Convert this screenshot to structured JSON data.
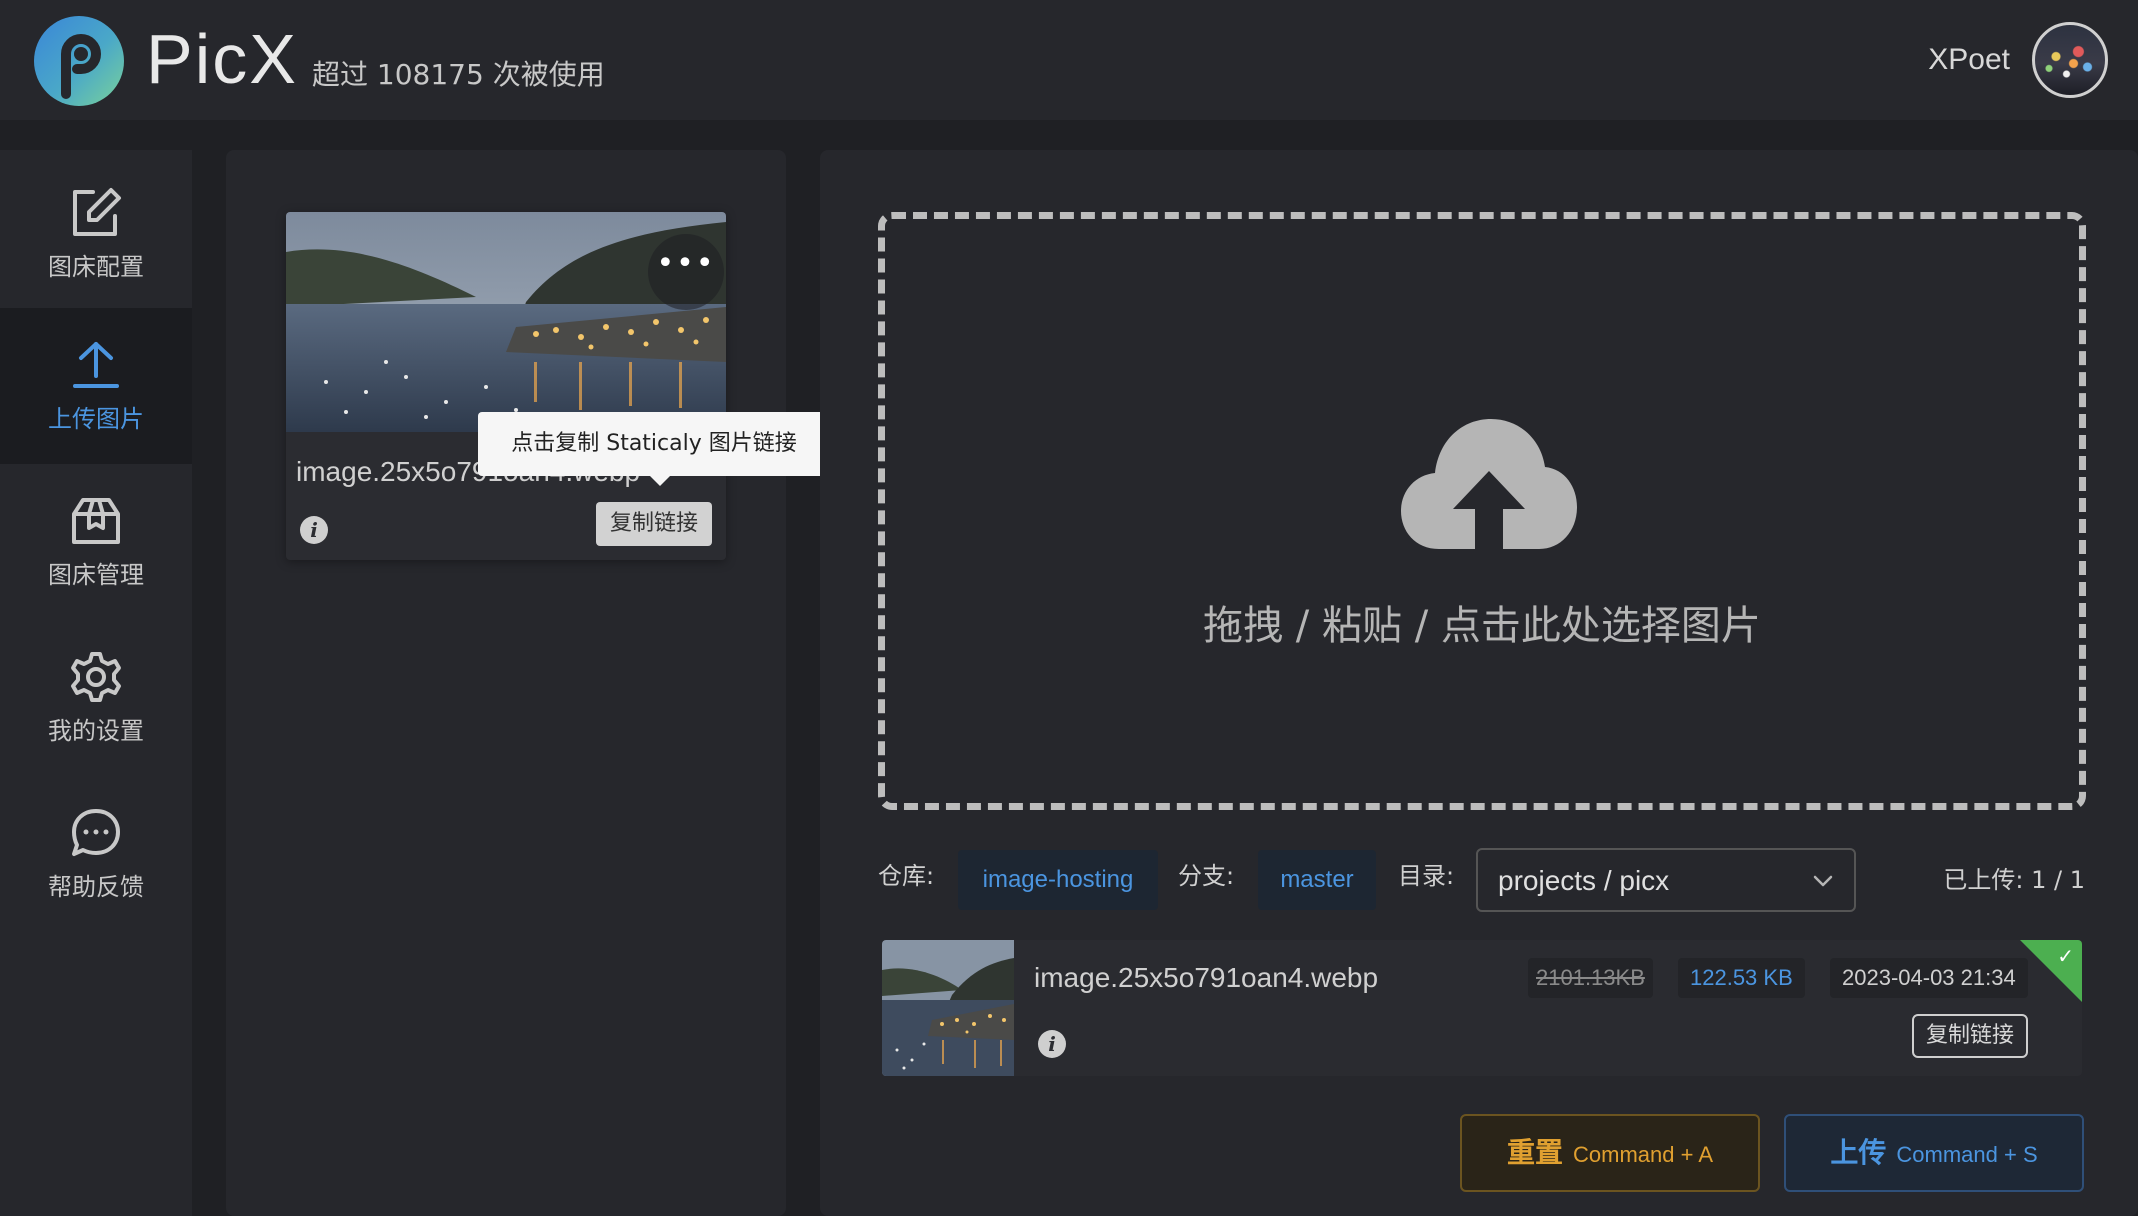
{
  "header": {
    "brand": "PicX",
    "usage": "超过 108175 次被使用",
    "username": "XPoet"
  },
  "sidebar": {
    "items": [
      {
        "label": "图床配置",
        "icon": "edit-icon"
      },
      {
        "label": "上传图片",
        "icon": "upload-icon"
      },
      {
        "label": "图床管理",
        "icon": "package-icon"
      },
      {
        "label": "我的设置",
        "icon": "gear-icon"
      },
      {
        "label": "帮助反馈",
        "icon": "chat-icon"
      }
    ],
    "active_index": 1
  },
  "history": {
    "card": {
      "filename": "image.25x5o791oan4.webp",
      "copy_label": "复制链接",
      "more_label": "•••"
    },
    "tooltip": "点击复制 Staticaly 图片链接"
  },
  "drop_zone": {
    "text": "拖拽 / 粘贴 / 点击此处选择图片"
  },
  "settings": {
    "repo_label": "仓库:",
    "repo_value": "image-hosting",
    "branch_label": "分支:",
    "branch_value": "master",
    "dir_label": "目录:",
    "dir_value": "projects / picx",
    "uploaded_count": "已上传: 1 / 1"
  },
  "uploaded_item": {
    "filename": "image.25x5o791oan4.webp",
    "original_size": "2101.13KB",
    "compressed_size": "122.53 KB",
    "time": "2023-04-03 21:34",
    "copy_label": "复制链接",
    "status": "success"
  },
  "actions": {
    "reset_label": "重置",
    "reset_shortcut": "Command + A",
    "upload_label": "上传",
    "upload_shortcut": "Command + S"
  },
  "colors": {
    "accent": "#4b95e0",
    "warning": "#e0a030",
    "success": "#4caf50",
    "background": "#1f2024",
    "panel": "#26272c"
  }
}
